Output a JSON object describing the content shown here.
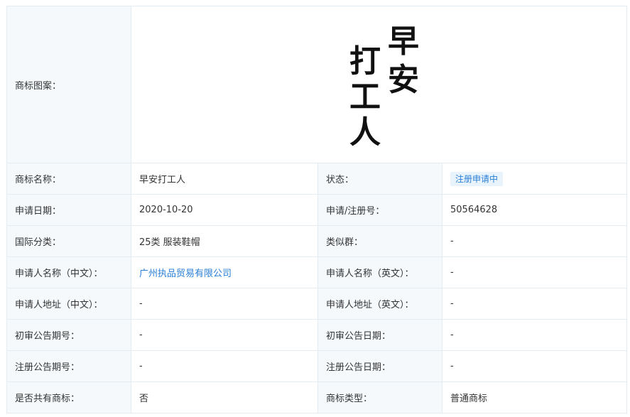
{
  "trademark": {
    "logo": {
      "label": "商标图案：",
      "lines": [
        "早安",
        "打工人"
      ]
    },
    "rows": [
      {
        "left_label": "商标名称：",
        "left_value": "早安打工人",
        "right_label": "状态：",
        "right_value": "注册申请中"
      },
      {
        "left_label": "申请日期：",
        "left_value": "2020-10-20",
        "right_label": "申请/注册号：",
        "right_value": "50564628"
      },
      {
        "left_label": "国际分类：",
        "left_value": "25类 服装鞋帽",
        "right_label": "类似群：",
        "right_value": "-"
      },
      {
        "left_label": "申请人名称（中文）：",
        "left_value": "广州执品贸易有限公司",
        "right_label": "申请人名称（英文）：",
        "right_value": "-"
      },
      {
        "left_label": "申请人地址（中文）：",
        "left_value": "-",
        "right_label": "申请人地址（英文）：",
        "right_value": "-"
      },
      {
        "left_label": "初审公告期号：",
        "left_value": "-",
        "right_label": "初审公告日期：",
        "right_value": "-"
      },
      {
        "left_label": "注册公告期号：",
        "left_value": "-",
        "right_label": "注册公告日期：",
        "right_value": "-"
      },
      {
        "left_label": "是否共有商标：",
        "left_value": "否",
        "right_label": "商标类型：",
        "right_value": "普通商标"
      }
    ]
  },
  "colors": {
    "label_bg": "#f5f9fc",
    "border": "#e4ebf1",
    "link": "#2a7fd4",
    "status_badge_bg": "#e8f3fc"
  }
}
